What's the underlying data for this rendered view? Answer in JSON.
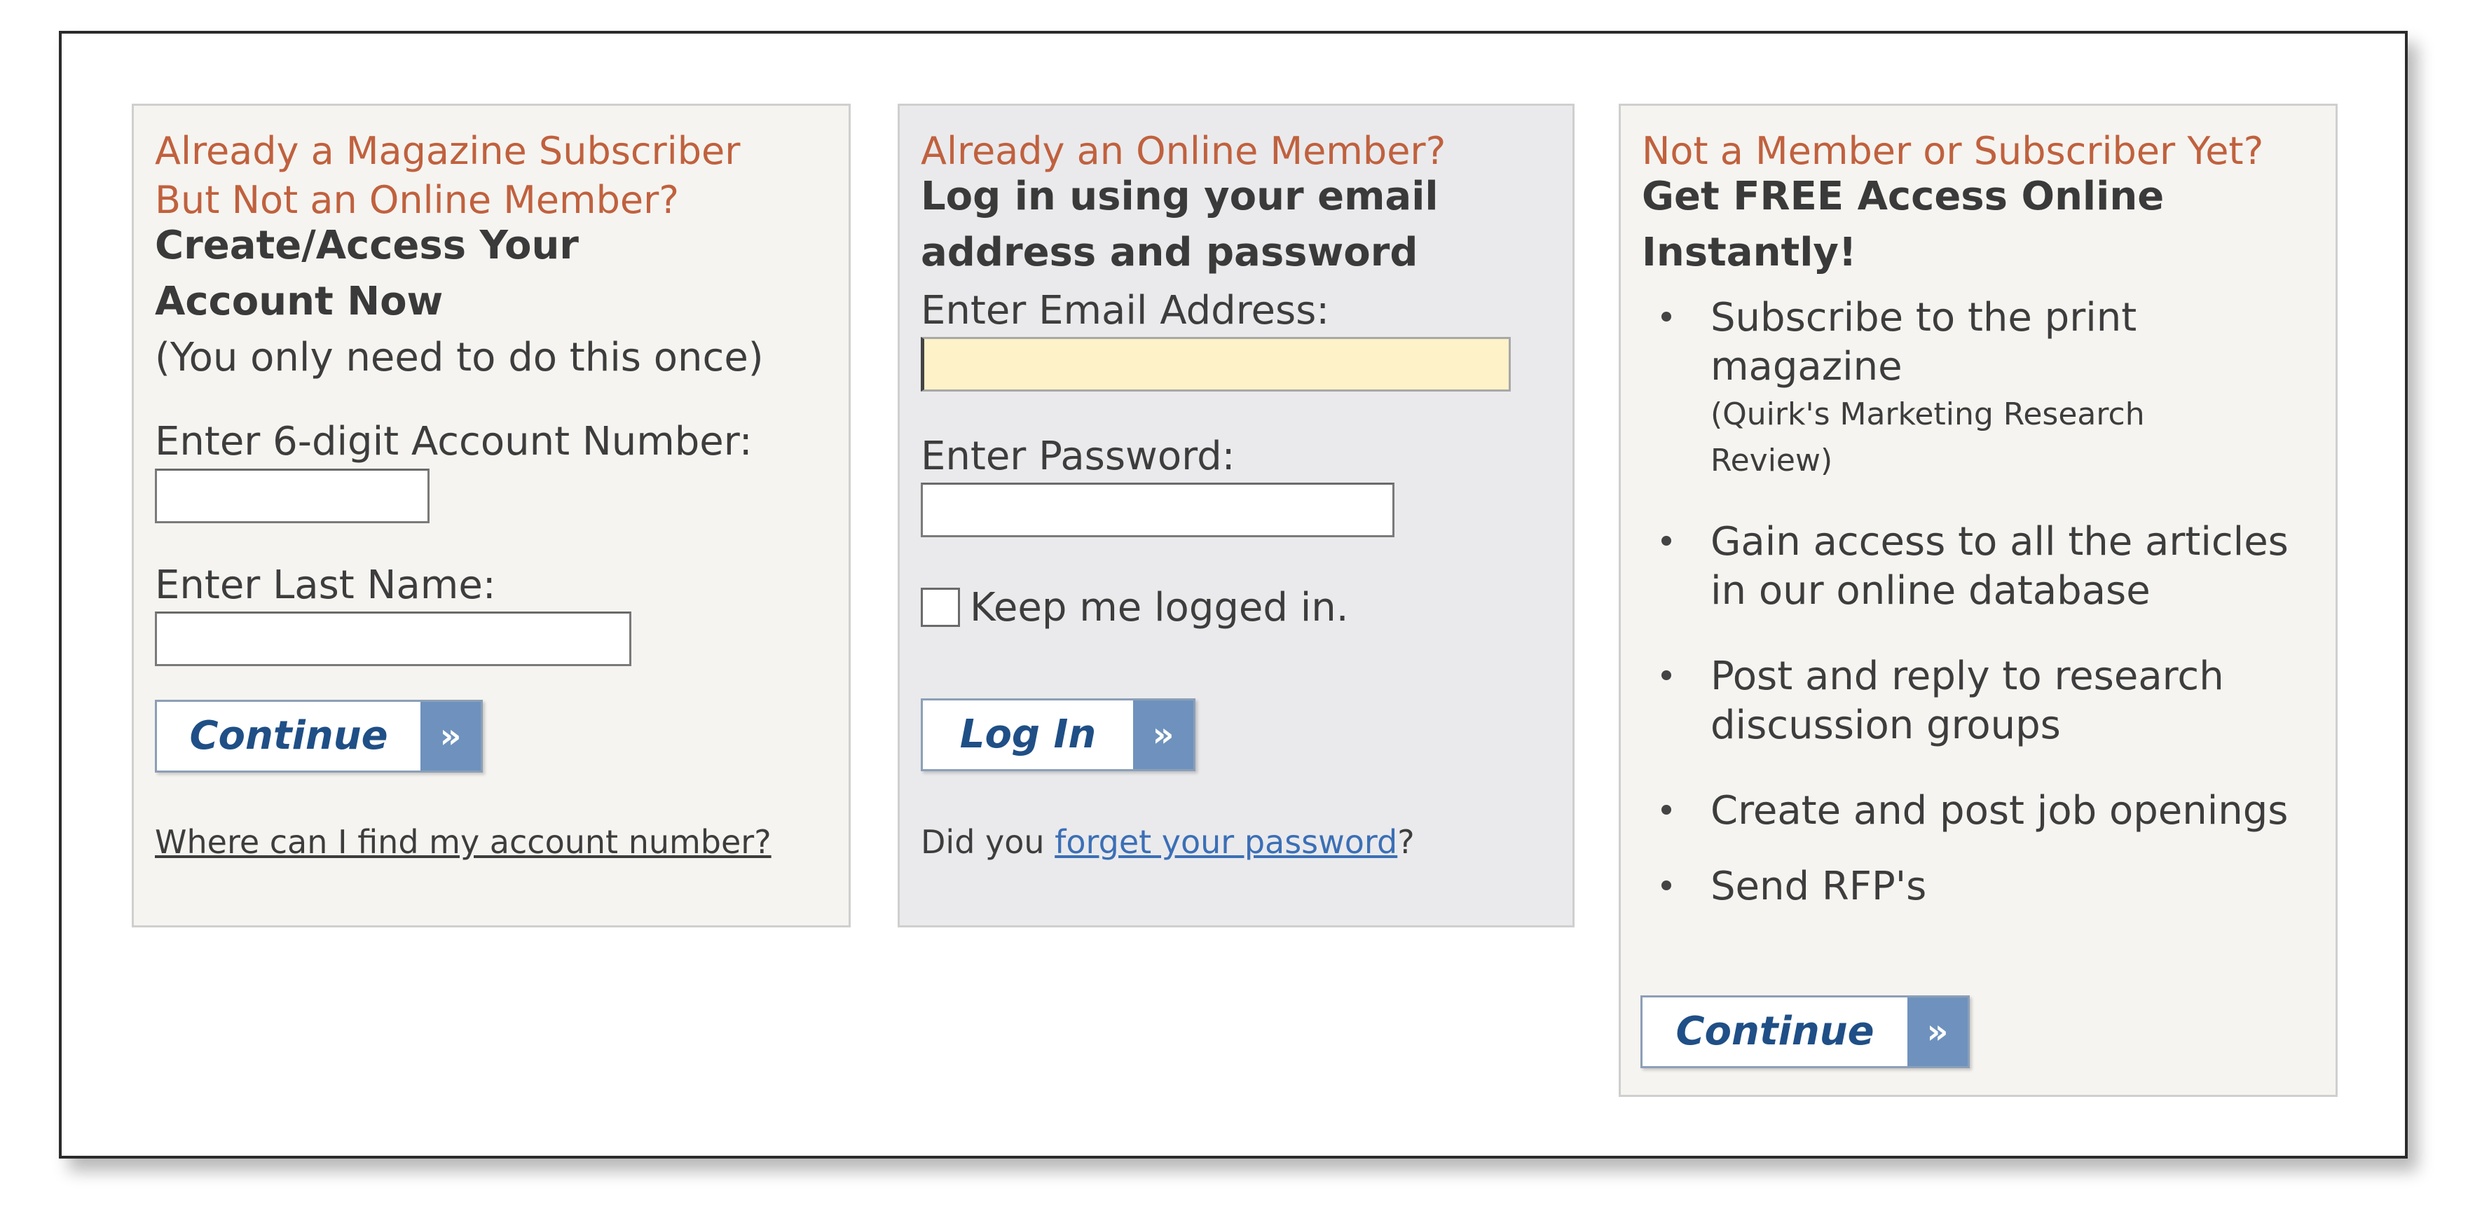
{
  "subscriber_panel": {
    "eyebrow_line1": "Already a Magazine Subscriber",
    "eyebrow_line2": "But Not an Online Member?",
    "heading_line1": "Create/Access Your",
    "heading_line2": "Account Now",
    "note": "(You only need to do this once)",
    "account_label": "Enter 6-digit Account Number:",
    "account_value": "",
    "lastname_label": "Enter Last Name:",
    "lastname_value": "",
    "continue_label": "Continue",
    "help_link": "Where can I find my account number?"
  },
  "member_panel": {
    "eyebrow": "Already an Online Member?",
    "heading_line1": "Log in using your email",
    "heading_line2": "address and password",
    "email_label": "Enter Email Address:",
    "email_value": "",
    "password_label": "Enter Password:",
    "password_value": "",
    "keep_logged_label": "Keep me logged in.",
    "keep_logged_checked": false,
    "login_label": "Log In",
    "forgot_prefix": "Did you ",
    "forgot_link": "forget your password",
    "forgot_suffix": "?"
  },
  "join_panel": {
    "eyebrow": "Not a Member or Subscriber Yet?",
    "heading_line1": "Get FREE Access Online",
    "heading_line2": "Instantly!",
    "benefits": [
      {
        "line1": "Subscribe to the print",
        "line2": "magazine",
        "sub1": "(Quirk's Marketing Research",
        "sub2": "Review)"
      },
      {
        "line1": "Gain access to all the articles",
        "line2": "in our online database"
      },
      {
        "line1": "Post and reply to research",
        "line2": "discussion groups"
      },
      {
        "line1": "Create and post job openings"
      },
      {
        "line1": "Send RFP's"
      }
    ],
    "continue_label": "Continue"
  },
  "icons": {
    "button_arrow": "double-chevron-right-icon",
    "bullet": "bullet-dot-icon"
  },
  "colors": {
    "eyebrow": "#c0613e",
    "button_text": "#1f4f86",
    "button_arrow_bg": "#6e92bd",
    "link": "#3b6fb6",
    "active_field": "#fdf2c8"
  }
}
